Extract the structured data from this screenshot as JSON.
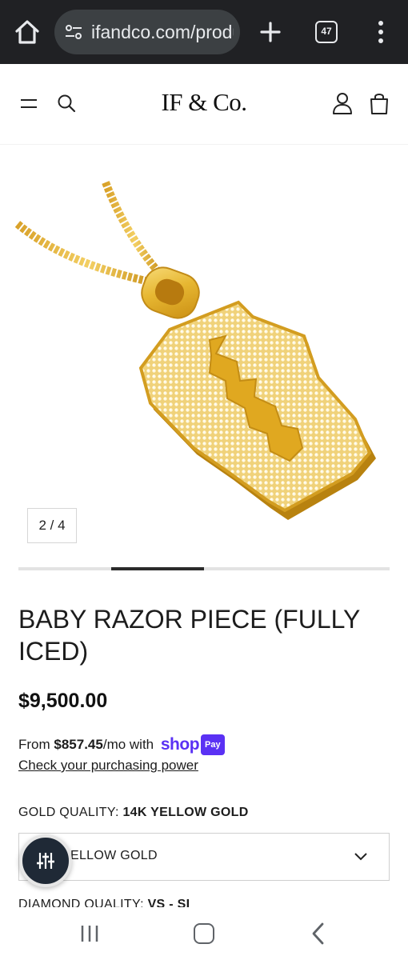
{
  "browser": {
    "url": "ifandco.com/products/baby-razor-piece",
    "tab_count": "47",
    "colors": {
      "bar": "#202124",
      "pill": "#3c4043",
      "text": "#e8eaed"
    }
  },
  "header": {
    "logo": "IF & Co.",
    "icons": [
      "menu-icon",
      "search-icon",
      "account-icon",
      "cart-icon"
    ]
  },
  "gallery": {
    "counter": "2 / 4",
    "current_image": 2,
    "total_images": 4
  },
  "product": {
    "title": "BABY RAZOR PIECE (FULLY ICED)",
    "price": "$9,500.00",
    "installment": {
      "prefix": "From ",
      "amount": "$857.45",
      "suffix": "/mo with",
      "brand": "shop",
      "badge": "Pay",
      "link": "Check your purchasing power"
    }
  },
  "options": {
    "gold_quality": {
      "label": "GOLD QUALITY:",
      "value": "14K YELLOW GOLD",
      "selected": "14K YELLOW GOLD",
      "select_visible_text": "ELLOW GOLD"
    },
    "diamond_quality": {
      "label": "DIAMOND QUALITY:",
      "value": "VS - SI"
    }
  },
  "colors": {
    "shop_pay": "#5a31f4",
    "gold": "#e6b52f",
    "filter_button": "#1f2936"
  }
}
